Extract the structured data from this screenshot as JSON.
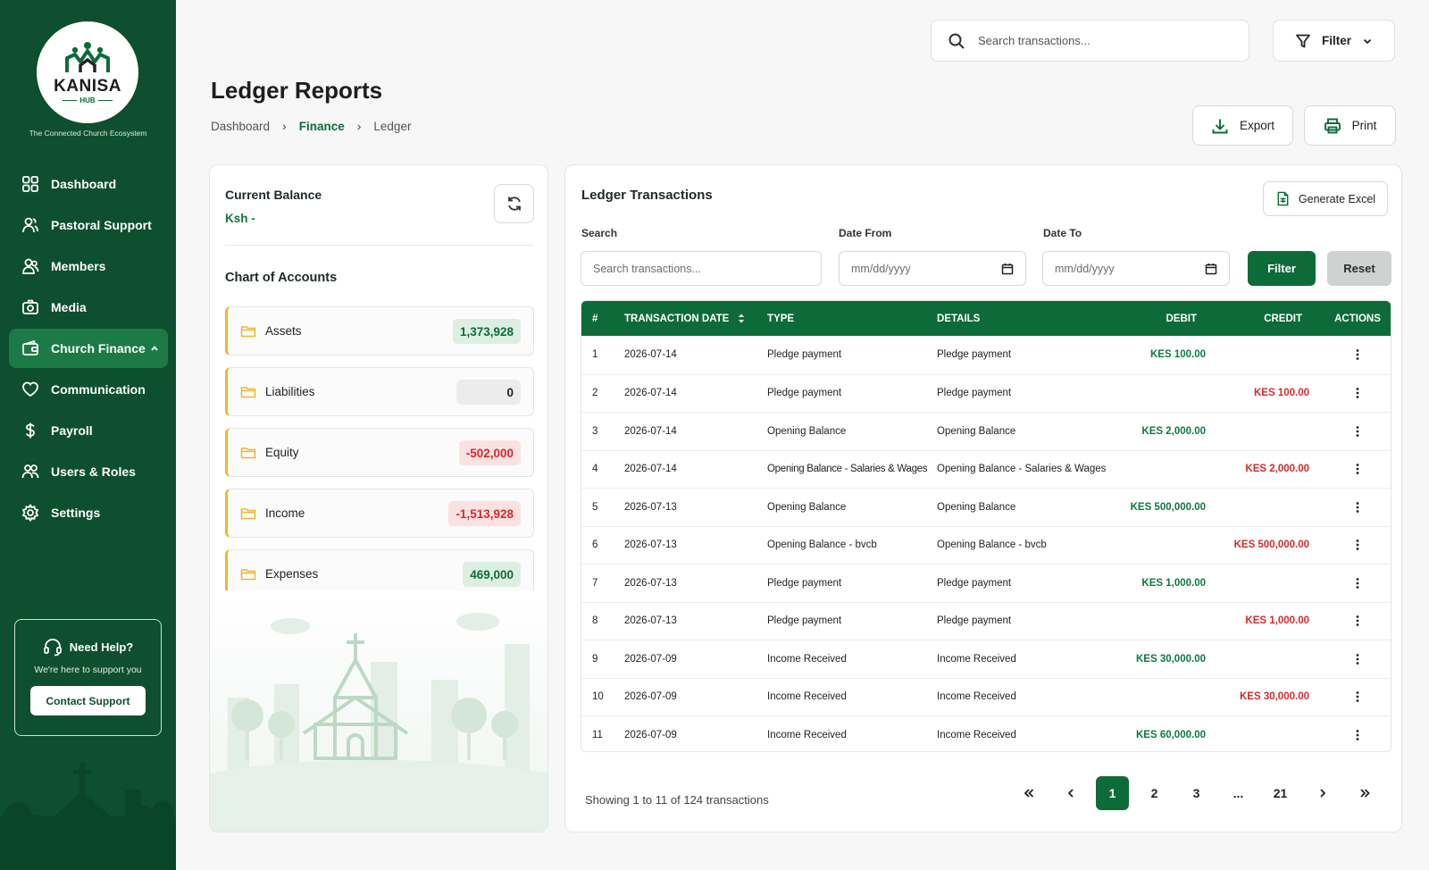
{
  "brand": {
    "name": "KANISA",
    "sub": "HUB",
    "tagline": "The Connected Church Ecosystem"
  },
  "nav": [
    {
      "label": "Dashboard",
      "icon": "grid-icon"
    },
    {
      "label": "Pastoral Support",
      "icon": "people-icon"
    },
    {
      "label": "Members",
      "icon": "members-icon"
    },
    {
      "label": "Media",
      "icon": "camera-icon"
    },
    {
      "label": "Church Finance",
      "icon": "wallet-icon",
      "active": true
    },
    {
      "label": "Communication",
      "icon": "heart-icon"
    },
    {
      "label": "Payroll",
      "icon": "dollar-icon"
    },
    {
      "label": "Users & Roles",
      "icon": "users-icon"
    },
    {
      "label": "Settings",
      "icon": "gear-icon"
    }
  ],
  "help": {
    "title": "Need Help?",
    "subtitle": "We're here to support you",
    "button": "Contact Support"
  },
  "topbar": {
    "search_placeholder": "Search transactions...",
    "filter_label": "Filter"
  },
  "page": {
    "title": "Ledger Reports",
    "breadcrumb": [
      "Dashboard",
      "Finance",
      "Ledger"
    ],
    "export_label": "Export",
    "print_label": "Print"
  },
  "balance": {
    "label": "Current Balance",
    "value": "Ksh -"
  },
  "chart_of_accounts": {
    "title": "Chart of Accounts",
    "accounts": [
      {
        "name": "Assets",
        "amount": "1,373,928",
        "kind": "pos"
      },
      {
        "name": "Liabilities",
        "amount": "0",
        "kind": "zero"
      },
      {
        "name": "Equity",
        "amount": "-502,000",
        "kind": "neg"
      },
      {
        "name": "Income",
        "amount": "-1,513,928",
        "kind": "neg"
      },
      {
        "name": "Expenses",
        "amount": "469,000",
        "kind": "pos"
      }
    ]
  },
  "ledger": {
    "title": "Ledger Transactions",
    "generate_excel": "Generate Excel",
    "filters": {
      "search_label": "Search",
      "search_placeholder": "Search transactions...",
      "date_from_label": "Date From",
      "date_from_placeholder": "mm/dd/yyyy",
      "date_to_label": "Date To",
      "date_to_placeholder": "mm/dd/yyyy",
      "filter_button": "Filter",
      "reset_button": "Reset"
    },
    "columns": [
      "#",
      "TRANSACTION DATE",
      "TYPE",
      "DETAILS",
      "DEBIT",
      "CREDIT",
      "ACTIONS"
    ],
    "rows": [
      {
        "num": "1",
        "date": "2026-07-14",
        "type": "Pledge payment",
        "details": "Pledge payment",
        "debit": "KES 100.00",
        "credit": ""
      },
      {
        "num": "2",
        "date": "2026-07-14",
        "type": "Pledge payment",
        "details": "Pledge payment",
        "debit": "",
        "credit": "KES 100.00"
      },
      {
        "num": "3",
        "date": "2026-07-14",
        "type": "Opening Balance",
        "details": "Opening Balance",
        "debit": "KES 2,000.00",
        "credit": ""
      },
      {
        "num": "4",
        "date": "2026-07-14",
        "type": "Opening Balance - Salaries & Wages",
        "details": "Opening Balance - Salaries & Wages",
        "debit": "",
        "credit": "KES 2,000.00"
      },
      {
        "num": "5",
        "date": "2026-07-13",
        "type": "Opening Balance",
        "details": "Opening Balance",
        "debit": "KES 500,000.00",
        "credit": ""
      },
      {
        "num": "6",
        "date": "2026-07-13",
        "type": "Opening Balance - bvcb",
        "details": "Opening Balance - bvcb",
        "debit": "",
        "credit": "KES 500,000.00"
      },
      {
        "num": "7",
        "date": "2026-07-13",
        "type": "Pledge payment",
        "details": "Pledge payment",
        "debit": "KES 1,000.00",
        "credit": ""
      },
      {
        "num": "8",
        "date": "2026-07-13",
        "type": "Pledge payment",
        "details": "Pledge payment",
        "debit": "",
        "credit": "KES 1,000.00"
      },
      {
        "num": "9",
        "date": "2026-07-09",
        "type": "Income Received",
        "details": "Income Received",
        "debit": "KES 30,000.00",
        "credit": ""
      },
      {
        "num": "10",
        "date": "2026-07-09",
        "type": "Income Received",
        "details": "Income Received",
        "debit": "",
        "credit": "KES 30,000.00"
      },
      {
        "num": "11",
        "date": "2026-07-09",
        "type": "Income Received",
        "details": "Income Received",
        "debit": "KES 60,000.00",
        "credit": ""
      }
    ],
    "showing": "Showing 1 to 11 of 124 transactions",
    "pages": [
      "1",
      "2",
      "3",
      "...",
      "21"
    ],
    "current_page": "1"
  },
  "colors": {
    "primary": "#0d6b3a",
    "sidebar": "#0d4f2e",
    "debit": "#0d7a3f",
    "credit": "#d52b2b",
    "accent_border": "#f2b632"
  }
}
